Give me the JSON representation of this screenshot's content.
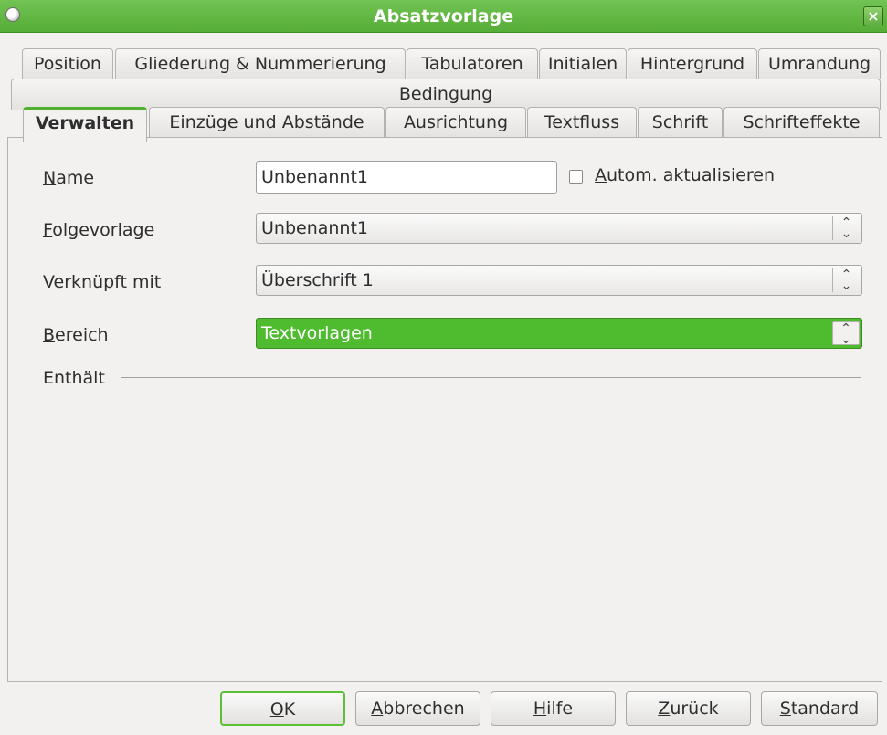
{
  "window": {
    "title": "Absatzvorlage",
    "close_glyph": "×"
  },
  "tabs_row1": [
    "Position",
    "Gliederung & Nummerierung",
    "Tabulatoren",
    "Initialen",
    "Hintergrund",
    "Umrandung"
  ],
  "tabs_row2": [
    "Bedingung"
  ],
  "tabs_row3": [
    "Verwalten",
    "Einzüge und Abstände",
    "Ausrichtung",
    "Textfluss",
    "Schrift",
    "Schrifteffekte"
  ],
  "active_tab": "Verwalten",
  "form": {
    "name": {
      "mnemonic": "N",
      "rest": "ame",
      "value": "Unbenannt1"
    },
    "autoupdate": {
      "mnemonic": "A",
      "rest": "utom. aktualisieren",
      "checked": false
    },
    "next_style": {
      "mnemonic": "F",
      "rest": "olgevorlage",
      "value": "Unbenannt1"
    },
    "linked_with": {
      "mnemonic": "V",
      "rest": "erknüpft mit",
      "value": "Überschrift 1"
    },
    "category": {
      "mnemonic": "B",
      "rest": "ereich",
      "value": "Textvorlagen"
    },
    "contains": "Enthält"
  },
  "buttons": {
    "ok": {
      "mnemonic": "O",
      "rest": "K"
    },
    "cancel": {
      "mnemonic": "A",
      "rest": "bbrechen"
    },
    "help": {
      "mnemonic": "H",
      "rest": "ilfe"
    },
    "reset": {
      "mnemonic": "Z",
      "rest": "urück"
    },
    "standard": {
      "mnemonic": "S",
      "rest": "tandard"
    }
  },
  "colors": {
    "accent": "#4fbb2f",
    "titlebar": "#5db73e"
  },
  "icons": {
    "app": "app-globe-icon",
    "close": "close-icon",
    "spin": "up-down-chevron-icon"
  }
}
